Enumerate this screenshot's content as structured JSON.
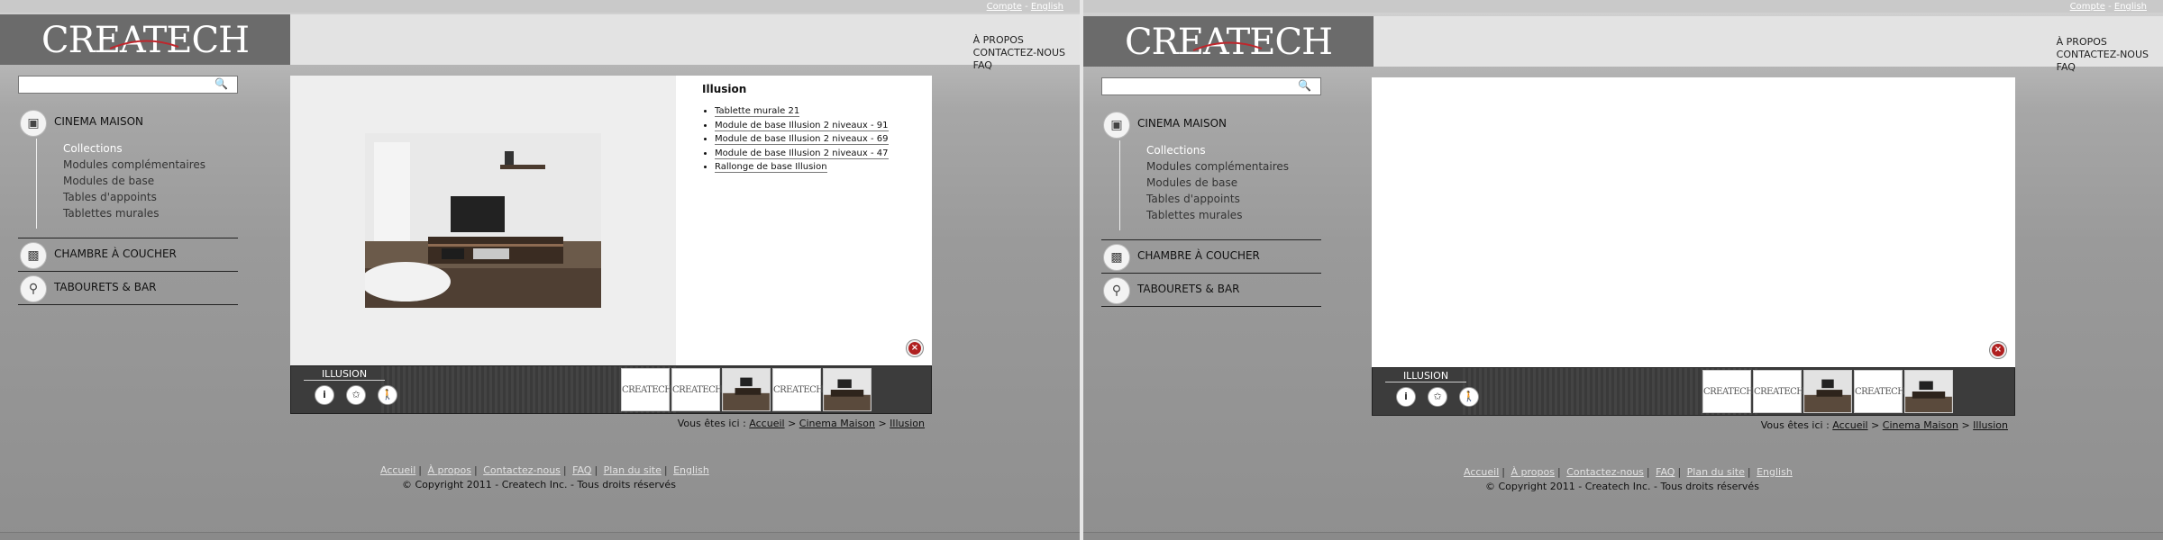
{
  "top_links": {
    "account": "Compte",
    "sep": "-",
    "language": "English"
  },
  "brand": {
    "logo": "CREATECH"
  },
  "header_nav": [
    "À PROPOS",
    "CONTACTEZ-NOUS",
    "FAQ"
  ],
  "search": {
    "value": "",
    "placeholder": ""
  },
  "sidebar": {
    "cinema": {
      "label": "CINEMA MAISON",
      "icon": "tv-icon"
    },
    "subitems": [
      "Collections",
      "Modules complémentaires",
      "Modules de base",
      "Tables d'appoints",
      "Tablettes murales"
    ],
    "chambre": {
      "label": "CHAMBRE À COUCHER",
      "icon": "bed-icon"
    },
    "tabourets": {
      "label": "TABOURETS & BAR",
      "icon": "stool-icon"
    }
  },
  "product": {
    "title": "Illusion",
    "items": [
      "Tablette murale 21",
      "Module de base Illusion 2 niveaux - 91",
      "Module de base Illusion 2 niveaux - 69",
      "Module de base Illusion 2 niveaux - 47",
      "Rallonge de base Illusion"
    ]
  },
  "strip": {
    "label": "ILLUSION",
    "thumb_logo": "CREATECH"
  },
  "breadcrumb": {
    "prefix": "Vous êtes ici :",
    "items": [
      "Accueil",
      "Cinema Maison",
      "Illusion"
    ],
    "sep": ">"
  },
  "footer": {
    "links": [
      "Accueil",
      "À propos",
      "Contactez-nous",
      "FAQ",
      "Plan du site",
      "English"
    ],
    "copyright": "© Copyright 2011 - Createch Inc. - Tous droits réservés"
  },
  "colors": {
    "accent_red": "#c0262c",
    "header_gray": "#6b6b6b",
    "close_red": "#b02020"
  }
}
